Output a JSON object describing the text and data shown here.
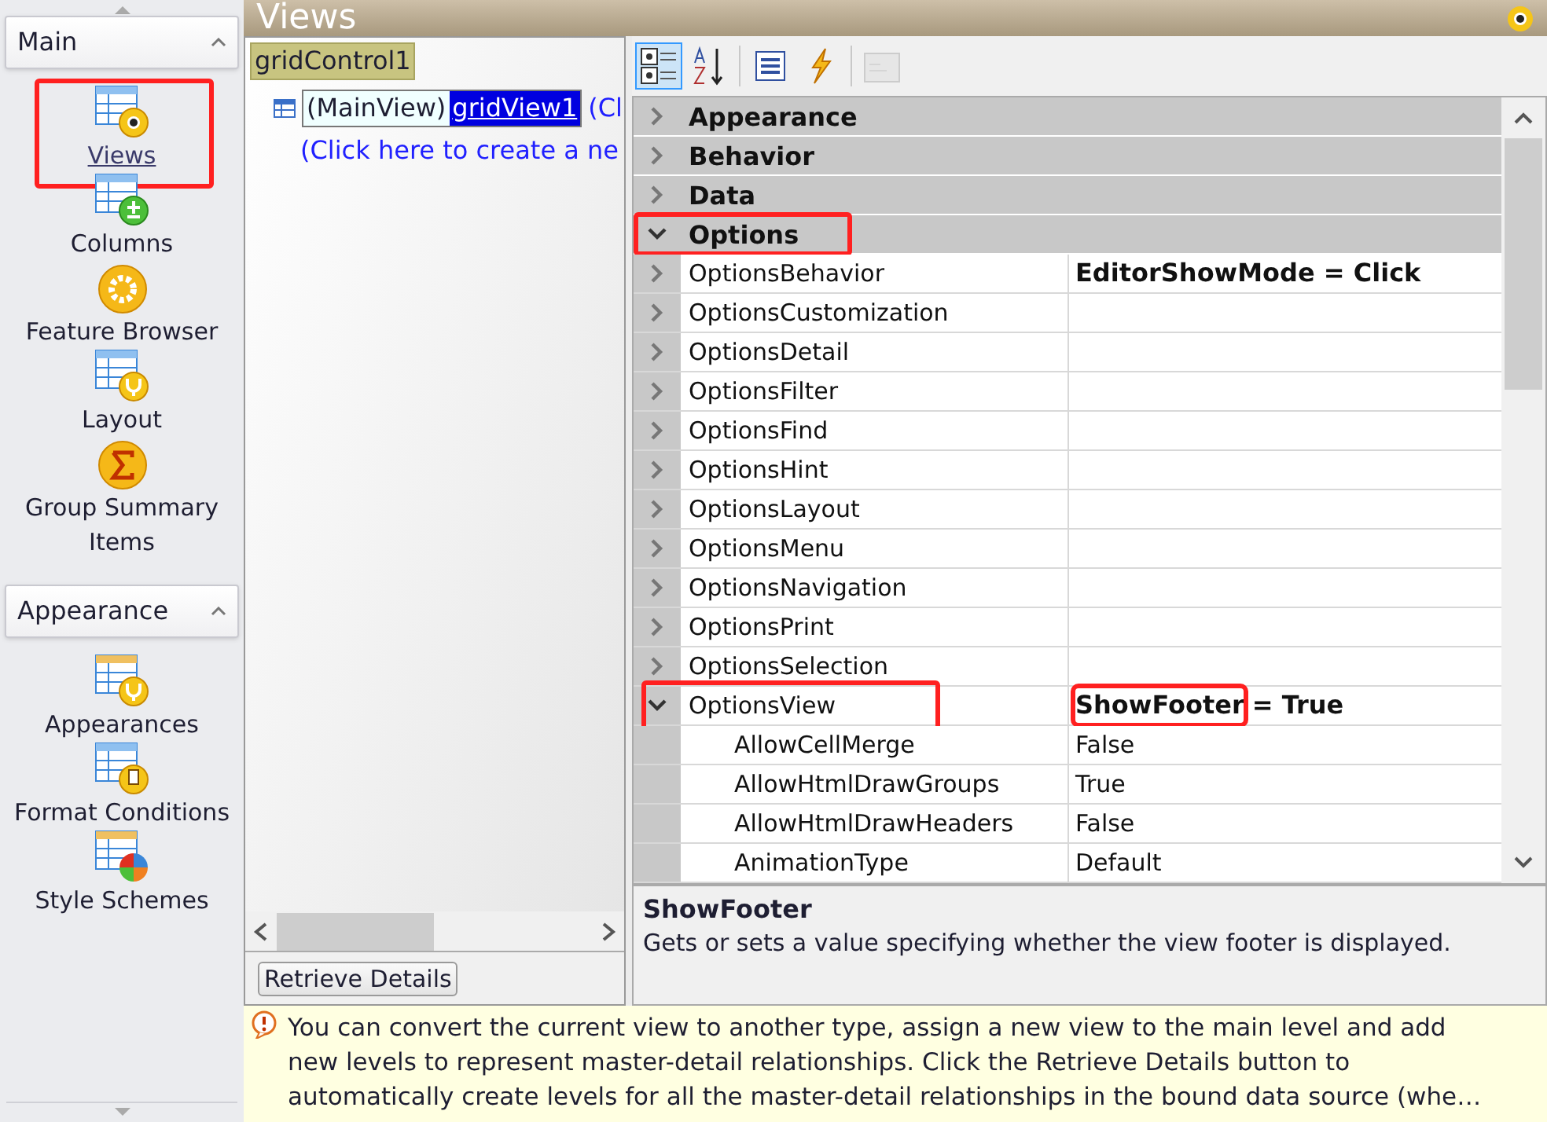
{
  "sidebar": {
    "groups": [
      {
        "title": "Main",
        "expanded": true,
        "items": [
          {
            "label": "Views",
            "selected": true,
            "highlighted": true
          },
          {
            "label": "Columns",
            "selected": false,
            "highlighted": false
          },
          {
            "label": "Feature Browser",
            "selected": false,
            "highlighted": false
          },
          {
            "label": "Layout",
            "selected": false,
            "highlighted": false
          },
          {
            "label": "Group Summary Items",
            "selected": false,
            "highlighted": false
          }
        ]
      },
      {
        "title": "Appearance",
        "expanded": true,
        "items": [
          {
            "label": "Appearances",
            "selected": false,
            "highlighted": false
          },
          {
            "label": "Format Conditions",
            "selected": false,
            "highlighted": false
          },
          {
            "label": "Style Schemes",
            "selected": false,
            "highlighted": false
          }
        ]
      }
    ]
  },
  "page_title": "Views",
  "tree": {
    "root": "gridControl1",
    "view_type": "(MainView)",
    "view_name": "gridView1",
    "view_note": "(Cl",
    "create_link": "(Click here to create a ne",
    "retrieve_button": "Retrieve Details"
  },
  "toolbar_buttons": [
    {
      "selected": true,
      "disabled": false
    },
    {
      "selected": false,
      "disabled": false
    },
    {
      "selected": false,
      "disabled": false
    },
    {
      "selected": false,
      "disabled": false
    },
    {
      "selected": false,
      "disabled": true
    }
  ],
  "properties": [
    {
      "kind": "category",
      "label": "Appearance",
      "expanded": false,
      "highlighted": false
    },
    {
      "kind": "category",
      "label": "Behavior",
      "expanded": false,
      "highlighted": false
    },
    {
      "kind": "category",
      "label": "Data",
      "expanded": false,
      "highlighted": false
    },
    {
      "kind": "category",
      "label": "Options",
      "expanded": true,
      "highlighted": true
    },
    {
      "kind": "group",
      "label": "OptionsBehavior",
      "expanded": false,
      "highlighted": false,
      "value_parts": [
        {
          "text": "EditorShowMode = Click",
          "highlighted": false
        }
      ],
      "modified": true
    },
    {
      "kind": "group",
      "label": "OptionsCustomization",
      "expanded": false,
      "highlighted": false
    },
    {
      "kind": "group",
      "label": "OptionsDetail",
      "expanded": false,
      "highlighted": false
    },
    {
      "kind": "group",
      "label": "OptionsFilter",
      "expanded": false,
      "highlighted": false
    },
    {
      "kind": "group",
      "label": "OptionsFind",
      "expanded": false,
      "highlighted": false
    },
    {
      "kind": "group",
      "label": "OptionsHint",
      "expanded": false,
      "highlighted": false
    },
    {
      "kind": "group",
      "label": "OptionsLayout",
      "expanded": false,
      "highlighted": false
    },
    {
      "kind": "group",
      "label": "OptionsMenu",
      "expanded": false,
      "highlighted": false
    },
    {
      "kind": "group",
      "label": "OptionsNavigation",
      "expanded": false,
      "highlighted": false
    },
    {
      "kind": "group",
      "label": "OptionsPrint",
      "expanded": false,
      "highlighted": false
    },
    {
      "kind": "group",
      "label": "OptionsSelection",
      "expanded": false,
      "highlighted": false
    },
    {
      "kind": "group",
      "label": "OptionsView",
      "expanded": true,
      "highlighted": true,
      "value_parts": [
        {
          "text": "ShowFooter",
          "highlighted": true
        },
        {
          "text": "= True",
          "highlighted": false
        }
      ],
      "modified": true
    },
    {
      "kind": "property",
      "label": "AllowCellMerge",
      "value_parts": [
        {
          "text": "False",
          "highlighted": false
        }
      ],
      "modified": false
    },
    {
      "kind": "property",
      "label": "AllowHtmlDrawGroups",
      "value_parts": [
        {
          "text": "True",
          "highlighted": false
        }
      ],
      "modified": false
    },
    {
      "kind": "property",
      "label": "AllowHtmlDrawHeaders",
      "value_parts": [
        {
          "text": "False",
          "highlighted": false
        }
      ],
      "modified": false
    },
    {
      "kind": "property",
      "label": "AnimationType",
      "value_parts": [
        {
          "text": "Default",
          "highlighted": false
        }
      ],
      "modified": false
    }
  ],
  "description": {
    "title": "ShowFooter",
    "text": "Gets or sets a value specifying whether the view footer is displayed."
  },
  "info": {
    "lines": [
      "You can convert the current view to another type, assign a new view to the main level and add",
      "new levels to represent master-detail relationships. Click the Retrieve Details button to",
      "automatically create levels for all the master-detail relationships in the bound data source (whe…"
    ]
  }
}
